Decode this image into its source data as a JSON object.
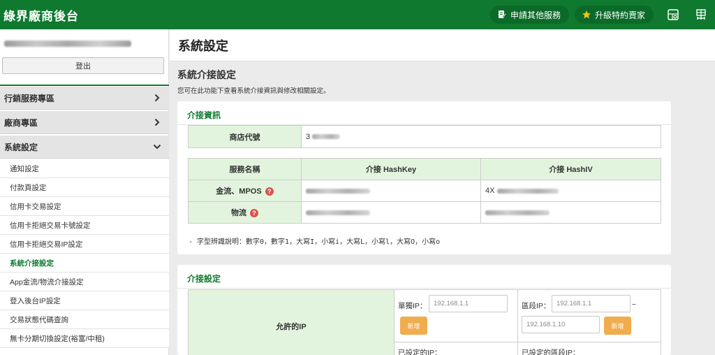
{
  "topbar": {
    "brand": "綠界廠商後台",
    "apply_service": "申請其他服務",
    "upgrade_seller": "升級特約賣家"
  },
  "sidebar": {
    "logout": "登出",
    "sections": [
      {
        "label": "行銷服務專區"
      },
      {
        "label": "廠商專區"
      },
      {
        "label": "系統設定"
      }
    ],
    "items": [
      {
        "label": "通知設定"
      },
      {
        "label": "付款頁設定"
      },
      {
        "label": "信用卡交易設定"
      },
      {
        "label": "信用卡拒絕交易卡號設定"
      },
      {
        "label": "信用卡拒絕交易IP設定"
      },
      {
        "label": "系統介接設定"
      },
      {
        "label": "App金流/物流介接設定"
      },
      {
        "label": "登入後台IP設定"
      },
      {
        "label": "交易狀態代碼查詢"
      },
      {
        "label": "無卡分期切換設定(裕富/中租)"
      }
    ]
  },
  "page": {
    "title": "系統設定",
    "section_title": "系統介接設定",
    "section_desc": "您可在此功能下查看系統介接資訊與修改相關設定。"
  },
  "info_card": {
    "title": "介接資訊",
    "merchant_id_label": "商店代號",
    "merchant_id_value": "3",
    "col_service": "服務名稱",
    "col_hashkey": "介接 HashKey",
    "col_hashiv": "介接 HashIV",
    "row_payment": "金流、MPOS",
    "row_logistics": "物流",
    "payment_hashiv_prefix": "4X",
    "help_mark": "?",
    "font_note": "- 字型辨識說明：數字0，數字1，大寫I，小寫i，大寫L，小寫l，大寫O，小寫o"
  },
  "settings_card": {
    "title": "介接設定",
    "allowed_ip_label": "允許的IP",
    "single_ip_label": "單獨IP：",
    "range_ip_label": "區段IP：",
    "single_ip_placeholder": "192.168.1.1",
    "range_start_placeholder": "192.168.1.1",
    "range_end_placeholder": "192.168.1.10",
    "tilde": "~",
    "add_label": "新增",
    "configured_ip_label": "已設定的IP：",
    "configured_range_label": "已設定的區段IP："
  },
  "icons": {
    "apply": "edit-document-icon",
    "upgrade": "star-icon",
    "grid": "grid-icon",
    "translate": "language-icon"
  },
  "colors": {
    "brand_green": "#0f7a2f",
    "label_bg": "#e2f4dd",
    "help_red": "#d9534f",
    "add_orange": "#f0ad4e"
  }
}
